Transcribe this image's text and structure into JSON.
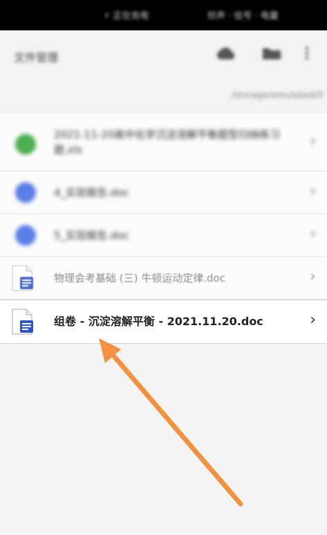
{
  "status_bar": {
    "center_text": "⚡ 正在充电",
    "right_text": "铃声 · 信号 · 电量"
  },
  "app_bar": {
    "title": "文件管理"
  },
  "path": {
    "text": "/storage/emulated/0"
  },
  "files": [
    {
      "name": "2021-11-20高中化学沉淀溶解平衡题型归纳练习题.xls",
      "icon_color": "#4caf50"
    },
    {
      "name": "4_实验报告.doc",
      "icon_color": "#5b7fe6"
    },
    {
      "name": "5_实验报告.doc",
      "icon_color": "#5b7fe6"
    },
    {
      "name": "物理会考基础 (三) 牛顿运动定律.doc",
      "icon_color": "#2f56c6"
    },
    {
      "name": "组卷 - 沉淀溶解平衡 - 2021.11.20.doc",
      "icon_color": "#2f56c6"
    }
  ],
  "chevron": "›",
  "annotation_color": "#f2913f"
}
